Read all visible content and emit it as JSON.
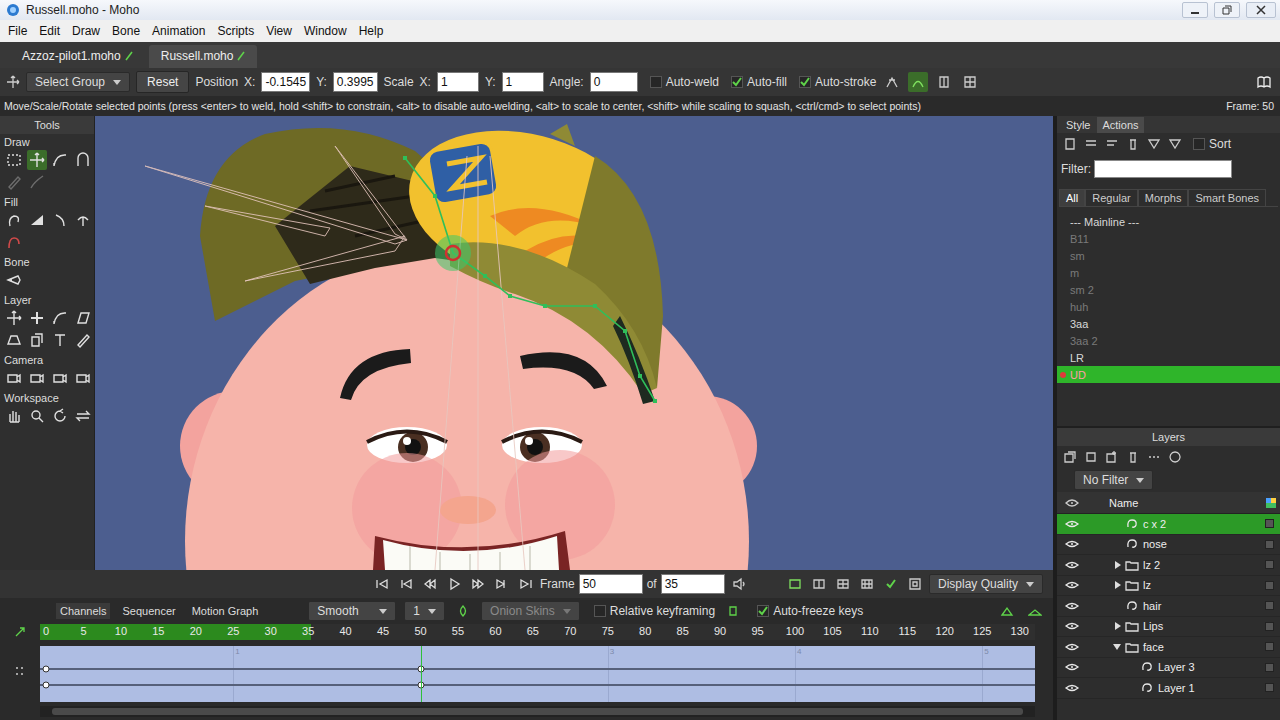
{
  "window": {
    "title": "Russell.moho - Moho"
  },
  "menu": [
    "File",
    "Edit",
    "Draw",
    "Bone",
    "Animation",
    "Scripts",
    "View",
    "Window",
    "Help"
  ],
  "documents": [
    {
      "label": "Azzoz-pilot1.moho",
      "selected": false
    },
    {
      "label": "Russell.moho",
      "selected": true
    }
  ],
  "tool_options": {
    "mode": "Select Group",
    "reset": "Reset",
    "position": "Position",
    "scale": "Scale",
    "position_fields": [
      {
        "label": "X:",
        "value": "-0.1545"
      },
      {
        "label": "Y:",
        "value": "0.3995"
      }
    ],
    "scale_fields": [
      {
        "label": "X:",
        "value": "1"
      },
      {
        "label": "Y:",
        "value": "1"
      }
    ],
    "angle": {
      "label": "Angle:",
      "value": "0"
    },
    "checks": [
      {
        "label": "Auto-weld",
        "checked": false
      },
      {
        "label": "Auto-fill",
        "checked": true
      },
      {
        "label": "Auto-stroke",
        "checked": true
      }
    ]
  },
  "status": {
    "hint": "Move/Scale/Rotate selected points (press <enter> to weld, hold <shift> to constrain, <alt> to disable auto-welding, <alt> to scale to center, <shift> while scaling to squash, <ctrl/cmd> to select points)",
    "frame": "Frame: 50"
  },
  "tools": {
    "title": "Tools",
    "sections": [
      {
        "title": "Draw",
        "icons": [
          {
            "selected": false,
            "disabled": false
          },
          {
            "selected": true,
            "disabled": false
          },
          {
            "selected": false,
            "disabled": false
          },
          {
            "selected": false,
            "disabled": false
          },
          {
            "selected": false,
            "disabled": true
          },
          {
            "selected": false,
            "disabled": true
          }
        ]
      },
      {
        "title": "Fill",
        "icons": [
          {
            "selected": false,
            "disabled": false
          },
          {
            "selected": false,
            "disabled": false
          },
          {
            "selected": false,
            "disabled": false
          },
          {
            "selected": false,
            "disabled": false
          },
          {
            "selected": false,
            "disabled": false
          }
        ]
      },
      {
        "title": "Bone",
        "icons": [
          {
            "selected": false,
            "disabled": false
          }
        ]
      },
      {
        "title": "Layer",
        "icons": [
          {
            "selected": false,
            "disabled": false
          },
          {
            "selected": false,
            "disabled": false
          },
          {
            "selected": false,
            "disabled": false
          },
          {
            "selected": false,
            "disabled": false
          },
          {
            "selected": false,
            "disabled": false
          },
          {
            "selected": false,
            "disabled": false
          },
          {
            "selected": false,
            "disabled": false
          },
          {
            "selected": false,
            "disabled": false
          }
        ]
      },
      {
        "title": "Camera",
        "icons": [
          {
            "selected": false,
            "disabled": false
          },
          {
            "selected": false,
            "disabled": false
          },
          {
            "selected": false,
            "disabled": false
          },
          {
            "selected": false,
            "disabled": false
          }
        ]
      },
      {
        "title": "Workspace",
        "icons": [
          {
            "selected": false,
            "disabled": false
          },
          {
            "selected": false,
            "disabled": false
          },
          {
            "selected": false,
            "disabled": false
          },
          {
            "selected": false,
            "disabled": false
          }
        ]
      }
    ]
  },
  "panel": {
    "tabs": [
      {
        "label": "Style",
        "selected": false
      },
      {
        "label": "Actions",
        "selected": true
      }
    ],
    "sort": {
      "label": "Sort",
      "checked": false
    },
    "filter_label": "Filter:",
    "filter_value": "",
    "action_tabs": [
      {
        "label": "All",
        "selected": true
      },
      {
        "label": "Regular",
        "selected": false
      },
      {
        "label": "Morphs",
        "selected": false
      },
      {
        "label": "Smart Bones",
        "selected": false
      }
    ],
    "actions": [
      {
        "name": "--- Mainline ---",
        "dimmed": false,
        "selected": false
      },
      {
        "name": "B11",
        "dimmed": true,
        "selected": false
      },
      {
        "name": "sm",
        "dimmed": true,
        "selected": false
      },
      {
        "name": "m",
        "dimmed": true,
        "selected": false
      },
      {
        "name": "sm 2",
        "dimmed": true,
        "selected": false
      },
      {
        "name": "huh",
        "dimmed": true,
        "selected": false
      },
      {
        "name": "3aa",
        "dimmed": false,
        "selected": false
      },
      {
        "name": "3aa 2",
        "dimmed": true,
        "selected": false
      },
      {
        "name": "LR",
        "dimmed": false,
        "selected": false
      },
      {
        "name": "UD",
        "dimmed": false,
        "selected": true
      }
    ]
  },
  "layers": {
    "title": "Layers",
    "filter": "No Filter",
    "column": "Name",
    "rows": [
      {
        "name": "c x 2",
        "kind": "vector",
        "depth": 0,
        "visible": true,
        "selected": true
      },
      {
        "name": "nose",
        "kind": "vector",
        "depth": 0,
        "visible": true,
        "selected": false
      },
      {
        "name": "lz 2",
        "kind": "group",
        "depth": 0,
        "visible": true,
        "selected": false,
        "expanded": false
      },
      {
        "name": "lz",
        "kind": "group",
        "depth": 0,
        "visible": true,
        "selected": false,
        "expanded": false
      },
      {
        "name": "hair",
        "kind": "vector",
        "depth": 0,
        "visible": true,
        "selected": false
      },
      {
        "name": "Lips",
        "kind": "group",
        "depth": 0,
        "visible": true,
        "selected": false,
        "expanded": false
      },
      {
        "name": "face",
        "kind": "group",
        "depth": 0,
        "visible": true,
        "selected": false,
        "expanded": true
      },
      {
        "name": "Layer 3",
        "kind": "vector",
        "depth": 1,
        "visible": true,
        "selected": false
      },
      {
        "name": "Layer 1",
        "kind": "vector",
        "depth": 1,
        "visible": true,
        "selected": false
      }
    ]
  },
  "playback": {
    "frame_label": "Frame",
    "frame": "50",
    "of_label": "of",
    "total": "35",
    "quality_checked": true,
    "quality": "Display Quality"
  },
  "timeline": {
    "tabs": [
      {
        "label": "Channels",
        "selected": true
      },
      {
        "label": "Sequencer",
        "selected": false
      },
      {
        "label": "Motion Graph",
        "selected": false
      }
    ],
    "interpolation": "Smooth",
    "step": "1",
    "onion": {
      "label": "Onion Skins",
      "enabled": false
    },
    "relative": {
      "label": "Relative keyframing",
      "checked": false
    },
    "autofreeze": {
      "label": "Auto-freeze keys",
      "checked": true
    },
    "ruler": [
      "0",
      "5",
      "10",
      "15",
      "20",
      "25",
      "30",
      "35",
      "40",
      "45",
      "50",
      "55",
      "60",
      "65",
      "70",
      "75",
      "80",
      "85",
      "90",
      "95",
      "100",
      "105",
      "110",
      "115",
      "120",
      "125",
      "130"
    ],
    "range_end": 35,
    "current_frame": 50,
    "seconds": [
      {
        "label": "1",
        "frame": 25
      },
      {
        "label": "3",
        "frame": 75
      },
      {
        "label": "4",
        "frame": 100
      },
      {
        "label": "5",
        "frame": 125
      }
    ],
    "tracks": [
      {
        "keys": [
          0,
          50
        ]
      },
      {
        "keys": [
          0,
          50
        ]
      }
    ]
  }
}
